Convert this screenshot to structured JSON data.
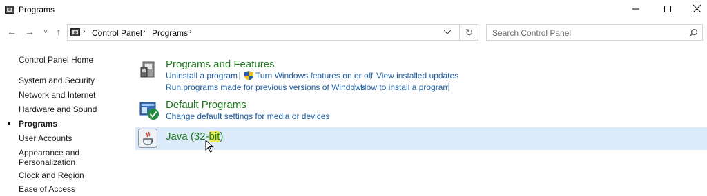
{
  "window": {
    "title": "Programs",
    "icons": {
      "app": "control-panel-icon",
      "minimize": "minimize-icon",
      "maximize": "maximize-icon",
      "close": "close-icon"
    }
  },
  "nav": {
    "back": "←",
    "forward": "→",
    "recent": "˅",
    "up": "↑",
    "breadcrumb": [
      "Control Panel",
      "Programs"
    ],
    "search_placeholder": "Search Control Panel"
  },
  "sidebar": {
    "items": [
      {
        "label": "Control Panel Home",
        "current": false
      },
      {
        "label": "System and Security",
        "current": false
      },
      {
        "label": "Network and Internet",
        "current": false
      },
      {
        "label": "Hardware and Sound",
        "current": false
      },
      {
        "label": "Programs",
        "current": true
      },
      {
        "label": "User Accounts",
        "current": false
      },
      {
        "label": "Appearance and",
        "current": false
      },
      {
        "label": "Personalization",
        "current": false
      },
      {
        "label": "Clock and Region",
        "current": false
      },
      {
        "label": "Ease of Access",
        "current": false
      }
    ]
  },
  "categories": [
    {
      "title": "Programs and Features",
      "icon": "programs-features-icon",
      "links": [
        "Uninstall a program",
        "Turn Windows features on or off",
        "View installed updates",
        "Run programs made for previous versions of Windows",
        "How to install a program"
      ]
    },
    {
      "title": "Default Programs",
      "icon": "default-programs-icon",
      "links": [
        "Change default settings for media or devices"
      ]
    },
    {
      "title_prefix": "Java (32-",
      "title_highlight": "bit",
      "title_suffix": ")",
      "icon": "java-icon"
    }
  ],
  "colors": {
    "category_title": "#1e7b1e",
    "link": "#1c5ea3",
    "selected_row": "#dcebf9",
    "highlight": "#e7ec5a"
  }
}
